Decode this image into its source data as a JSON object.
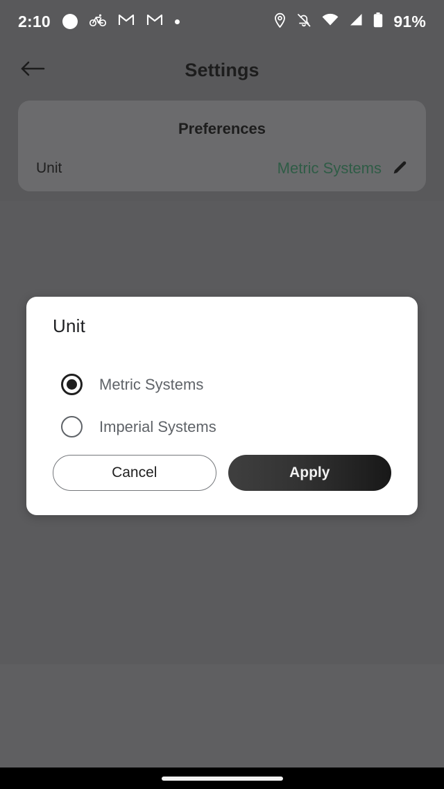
{
  "status_bar": {
    "time": "2:10",
    "battery_percent": "91%",
    "left_icons": [
      "white-circle-icon",
      "bicycle-icon",
      "gmail-icon",
      "gmail-icon",
      "small-dot-icon"
    ],
    "right_icons": [
      "location-pin-icon",
      "notifications-muted-icon",
      "wifi-icon",
      "cellular-signal-icon",
      "battery-icon"
    ]
  },
  "top_bar": {
    "back_icon": "arrow-left-icon",
    "title": "Settings"
  },
  "preferences_card": {
    "title": "Preferences",
    "unit_label": "Unit",
    "unit_value": "Metric Systems",
    "unit_value_color": "#2f5c46",
    "edit_icon": "pencil-icon"
  },
  "dialog": {
    "title": "Unit",
    "options": [
      {
        "label": "Metric Systems",
        "selected": true
      },
      {
        "label": "Imperial Systems",
        "selected": false
      }
    ],
    "cancel_label": "Cancel",
    "apply_label": "Apply"
  },
  "nav_bar": {
    "handle": "gesture-home-handle"
  }
}
